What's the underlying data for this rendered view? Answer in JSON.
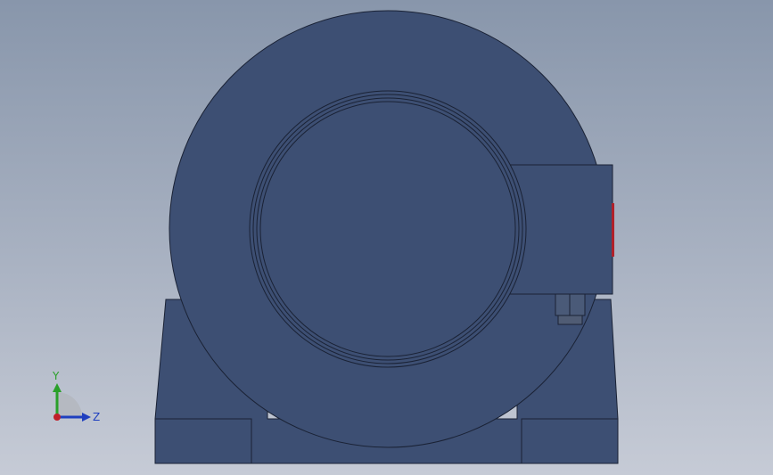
{
  "viewport": {
    "background_top": "#8896ab",
    "background_bottom": "#c6cbd6",
    "model_color": "#3d4f73",
    "edge_color": "#1a2235",
    "accent_red": "#b0202a"
  },
  "triad": {
    "y_label": "Y",
    "z_label": "Z",
    "y_color": "#2aa02a",
    "z_color": "#1f3fbf",
    "x_color": "#c0202a"
  }
}
